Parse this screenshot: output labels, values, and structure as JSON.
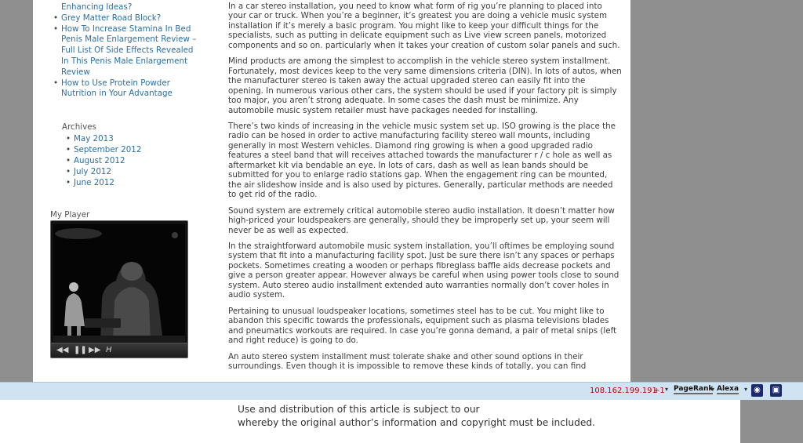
{
  "sidebar": {
    "recent_posts": [
      "Enhancing Ideas?",
      "Grey Matter Road Block?",
      "How To Increase Stamina In Bed Penis Male Enlargement Review – Full List Of Side Effects Revealed In This Penis Male Enlargement Review",
      "How to Use Protein Powder Nutrition in Your Advantage"
    ],
    "archives_title": "Archives",
    "archives": [
      "May 2013",
      "September 2012",
      "August 2012",
      "July 2012",
      "June 2012"
    ],
    "player_title": "My Player",
    "player_controls": {
      "rewind": "◀◀",
      "pause": "❚❚",
      "forward": "▶▶",
      "end": "H"
    }
  },
  "article": {
    "paragraphs": [
      "In a car stereo installation, you need to know what form of rig you’re planning to placed into your car or truck. When you’re a beginner, it’s greatest you are doing a vehicle music system installation if it’s merely a basic program. You might like to keep your difficult things for the specialists, such as putting in delicate equipment such as Live view screen panels, motorized components and so on. particularly when it takes your creation of custom solar panels and such.",
      "Mind products are among the simplest to accomplish in the vehicle stereo system installment. Fortunately, most devices keep to the very same dimensions criteria (DIN). In lots of autos, when the manufacturer stereo is taken away the actual upgraded stereo can easily fit into the opening. In numerous various other cars, the system should be used if your factory pit is simply too major, you aren’t strong adequate. In some cases the dash must be minimize. Any automobile music system retailer must have packages needed for installing.",
      "There’s two kinds of increasing in the vehicle music system set up. ISO growing is the place the radio can be hosed in order to active manufacturing facility stereo wall mounts, including generally in most Western vehicles. Diamond ring growing is when a good upgraded radio features a steel band that will receives attached towards the manufacturer r / c hole as well as aftermarket kit via bendable an eye. In lots of cars, dash as well as lean bands should be submitted for you to enlarge radio stations gap. When the engagement ring can be mounted, the air slideshow inside and is also used by pictures. Generally, particular methods are needed to get rid of the radio.",
      "Sound system are extremely critical automobile stereo audio installation. It doesn’t matter how high-priced your loudspeakers are generally, should they be improperly set up, your seem will never be as well as expected.",
      "In the straightforward automobile music system installation, you’ll oftimes be employing sound system that fit into a manufacturing facility spot. Just be sure there isn’t any spaces or perhaps pockets. Sometimes creating a wooden or perhaps fibreglass baffle aids decrease pockets and give a person greater appear. However always be careful when using power tools close to sound system. Auto stereo audio installment extended auto warranties normally don’t cover holes in audio system.",
      "Pertaining to unusual loudspeaker locations, sometimes steel has to be cut. You might like to abandon this specific towards the professionals, equipment such as plasma televisions blades and pneumatics workouts are required. In case you’re gonna demand, a pair of metal snips (left and right reduce) is going to do.",
      "An auto stereo system installment must tolerate shake and other sound options in their surroundings. Even though it is impossible to remove these kinds of totally, you can find"
    ]
  },
  "toolbar": {
    "ip": "108.162.199.191",
    "ip_plus": "+1",
    "pagerank": "PageRank",
    "alexa": "Alexa"
  },
  "footer": {
    "line1": "Use and distribution of this article is subject to our",
    "line2": "whereby the original author’s information and copyright must be included."
  }
}
